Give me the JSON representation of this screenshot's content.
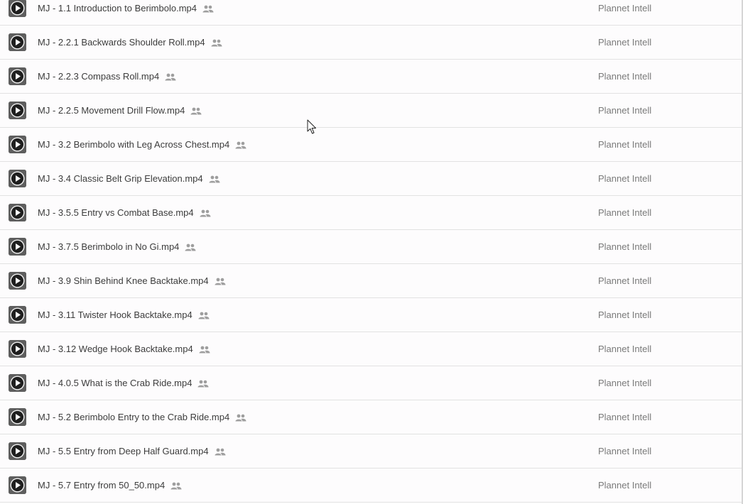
{
  "files": [
    {
      "name": "MJ - 1.1 Introduction to Berimbolo.mp4",
      "owner": "Plannet Intell"
    },
    {
      "name": "MJ - 2.2.1 Backwards Shoulder Roll.mp4",
      "owner": "Plannet Intell"
    },
    {
      "name": "MJ - 2.2.3 Compass Roll.mp4",
      "owner": "Plannet Intell"
    },
    {
      "name": "MJ - 2.2.5 Movement Drill Flow.mp4",
      "owner": "Plannet Intell"
    },
    {
      "name": "MJ - 3.2 Berimbolo with Leg Across Chest.mp4",
      "owner": "Plannet Intell"
    },
    {
      "name": "MJ - 3.4 Classic Belt Grip Elevation.mp4",
      "owner": "Plannet Intell"
    },
    {
      "name": "MJ - 3.5.5 Entry vs Combat Base.mp4",
      "owner": "Plannet Intell"
    },
    {
      "name": "MJ - 3.7.5 Berimbolo in No Gi.mp4",
      "owner": "Plannet Intell"
    },
    {
      "name": "MJ - 3.9 Shin Behind Knee Backtake.mp4",
      "owner": "Plannet Intell"
    },
    {
      "name": "MJ - 3.11 Twister Hook Backtake.mp4",
      "owner": "Plannet Intell"
    },
    {
      "name": "MJ - 3.12 Wedge Hook Backtake.mp4",
      "owner": "Plannet Intell"
    },
    {
      "name": "MJ - 4.0.5 What is the Crab Ride.mp4",
      "owner": "Plannet Intell"
    },
    {
      "name": "MJ - 5.2 Berimbolo Entry to the Crab Ride.mp4",
      "owner": "Plannet Intell"
    },
    {
      "name": "MJ - 5.5 Entry from Deep Half Guard.mp4",
      "owner": "Plannet Intell"
    },
    {
      "name": "MJ - 5.7 Entry from 50_50.mp4",
      "owner": "Plannet Intell"
    }
  ],
  "icons": {
    "thumbnail": "video-play-icon",
    "shared": "shared-people-icon",
    "cursor": "mouse-pointer-icon"
  },
  "colors": {
    "text": "#3c3c3c",
    "owner_text": "#7a7a7a",
    "divider": "#e2e2e2",
    "icon_gray": "#9e9e9e"
  }
}
